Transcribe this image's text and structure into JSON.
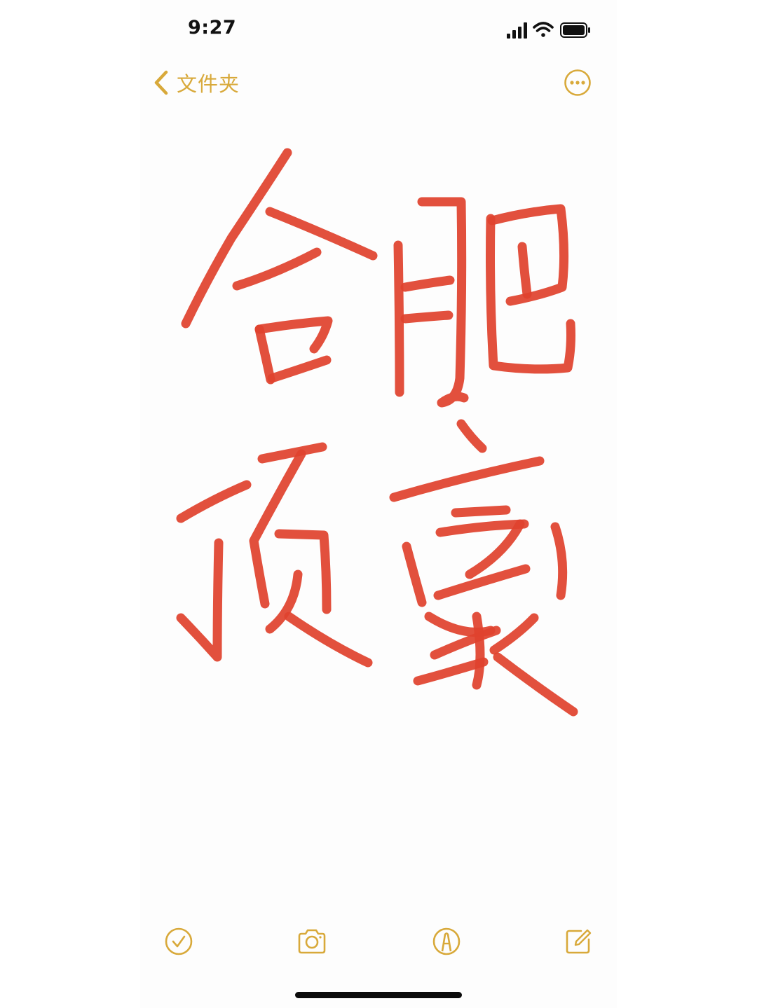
{
  "status_bar": {
    "time": "9:27",
    "icons": [
      "cellular-signal-icon",
      "wifi-icon",
      "battery-icon"
    ]
  },
  "nav": {
    "back_label": "文件夹",
    "back_icon": "chevron-left-icon",
    "more_icon": "ellipsis-circle-icon"
  },
  "note": {
    "handwritten_text": "合肥顶豪",
    "ink_color": "#e0432e"
  },
  "toolbar": {
    "items": [
      "checklist-icon",
      "camera-icon",
      "markup-pen-icon",
      "compose-icon"
    ]
  },
  "colors": {
    "accent": "#d8a93a",
    "background": "#ffffff",
    "ink": "#e0432e"
  }
}
